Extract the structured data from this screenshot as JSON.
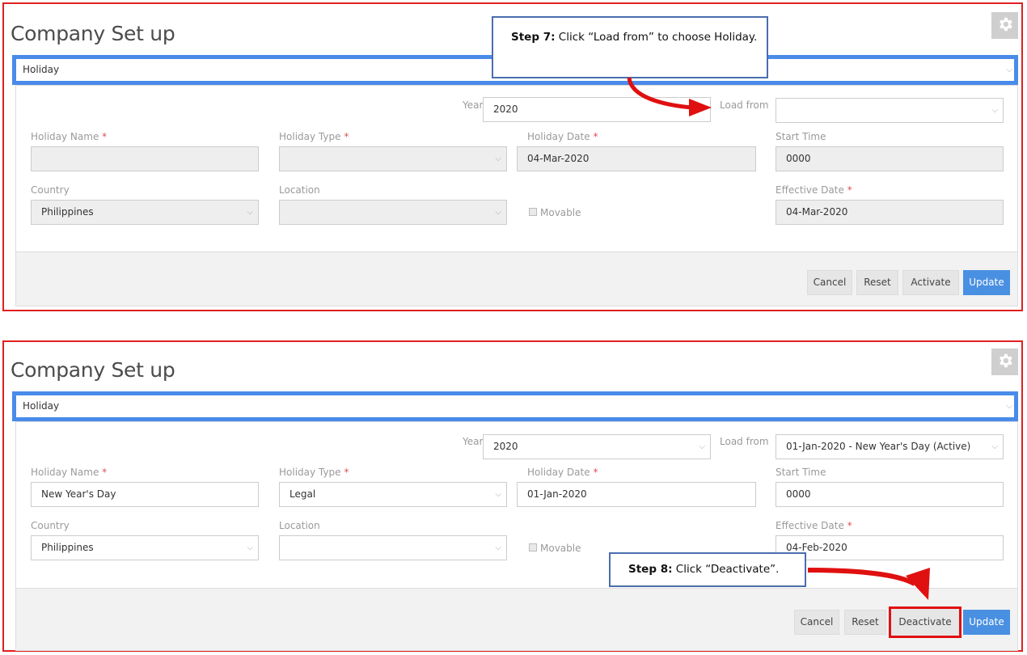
{
  "panels": [
    {
      "title": "Company Set up",
      "selector": "Holiday",
      "year_label": "Year",
      "year_value": "2020",
      "load_from_label": "Load from",
      "load_from_value": "",
      "holiday_name_label": "Holiday Name",
      "holiday_name_value": "",
      "holiday_type_label": "Holiday Type",
      "holiday_type_value": "",
      "holiday_date_label": "Holiday Date",
      "holiday_date_value": "04-Mar-2020",
      "start_time_label": "Start Time",
      "start_time_value": "0000",
      "country_label": "Country",
      "country_value": "Philippines",
      "location_label": "Location",
      "location_value": "",
      "movable_label": "Movable",
      "effective_date_label": "Effective Date",
      "effective_date_value": "04-Mar-2020",
      "buttons": {
        "cancel": "Cancel",
        "reset": "Reset",
        "toggle": "Activate",
        "update": "Update"
      },
      "callout_bold": "Step 7:",
      "callout_text": " Click “Load from” to choose Holiday."
    },
    {
      "title": "Company Set up",
      "selector": "Holiday",
      "year_label": "Year",
      "year_value": "2020",
      "load_from_label": "Load from",
      "load_from_value": "01-Jan-2020 - New Year's Day (Active)",
      "holiday_name_label": "Holiday Name",
      "holiday_name_value": "New Year's Day",
      "holiday_type_label": "Holiday Type",
      "holiday_type_value": "Legal",
      "holiday_date_label": "Holiday Date",
      "holiday_date_value": "01-Jan-2020",
      "start_time_label": "Start Time",
      "start_time_value": "0000",
      "country_label": "Country",
      "country_value": "Philippines",
      "location_label": "Location",
      "location_value": "",
      "movable_label": "Movable",
      "effective_date_label": "Effective Date",
      "effective_date_value": "04-Feb-2020",
      "buttons": {
        "cancel": "Cancel",
        "reset": "Reset",
        "toggle": "Deactivate",
        "update": "Update"
      },
      "callout_bold": "Step 8:",
      "callout_text": " Click “Deactivate”."
    }
  ],
  "required_mark": "*",
  "icons": {
    "settings": "gear-icon",
    "dropdown": "chevron-down-icon",
    "checkbox": "checkbox-icon"
  },
  "colors": {
    "frame": "#e02020",
    "accent": "#4a8bea",
    "primary_button": "#4a90e2",
    "callout_border": "#4a6eae",
    "arrow": "#e01010"
  }
}
